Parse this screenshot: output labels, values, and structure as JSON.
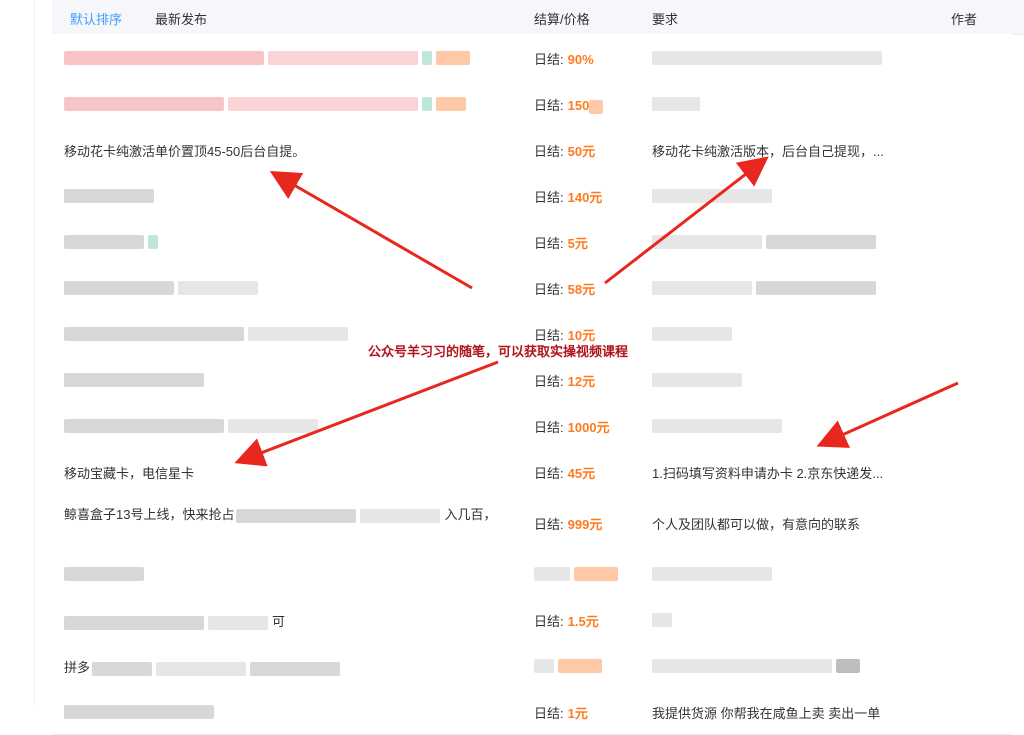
{
  "header": {
    "tab_default": "默认排序",
    "tab_latest": "最新发布",
    "col_pay": "结算/价格",
    "col_req": "要求",
    "col_author": "作者"
  },
  "overlay": {
    "text": "公众号羊习习的随笔，可以获取实操视频课程"
  },
  "rows": [
    {
      "title": "",
      "pay_label": "日结:",
      "amount": "90%",
      "req": ""
    },
    {
      "title": "",
      "pay_label": "日结:",
      "amount": "150",
      "req": ""
    },
    {
      "title": "移动花卡纯激活单价置顶45-50后台自提。",
      "pay_label": "日结:",
      "amount": "50元",
      "req": "移动花卡纯激活版本，后台自己提现，..."
    },
    {
      "title": "",
      "pay_label": "日结:",
      "amount": "140元",
      "req": ""
    },
    {
      "title": "",
      "pay_label": "日结:",
      "amount": "5元",
      "req": ""
    },
    {
      "title": "",
      "pay_label": "日结:",
      "amount": "58元",
      "req": ""
    },
    {
      "title": "",
      "pay_label": "日结:",
      "amount": "10元",
      "req": ""
    },
    {
      "title": "",
      "pay_label": "日结:",
      "amount": "12元",
      "req": ""
    },
    {
      "title": "",
      "pay_label": "日结:",
      "amount": "1000元",
      "req": ""
    },
    {
      "title": "移动宝藏卡，电信星卡",
      "pay_label": "日结:",
      "amount": "45元",
      "req": "1.扫码填写资料申请办卡 2.京东快递发..."
    },
    {
      "title": "鲸喜盒子13号上线，快来抢占",
      "title_tail": "入几百，",
      "pay_label": "日结:",
      "amount": "999元",
      "req": "个人及团队都可以做，有意向的联系"
    },
    {
      "title": "",
      "pay_label": "",
      "amount": "",
      "req": ""
    },
    {
      "title": "",
      "title_tail": "可",
      "pay_label": "日结:",
      "amount": "1.5元",
      "req": ""
    },
    {
      "title": "拼多",
      "pay_label": "",
      "amount": "",
      "req": ""
    },
    {
      "title": "",
      "pay_label": "日结:",
      "amount": "1元",
      "req": "我提供货源 你帮我在咸鱼上卖 卖出一单"
    }
  ],
  "colors": {
    "accent": "#409eff",
    "amount": "#ff7a1f",
    "arrow": "#e8281f",
    "overlay_text": "#b0141c"
  }
}
